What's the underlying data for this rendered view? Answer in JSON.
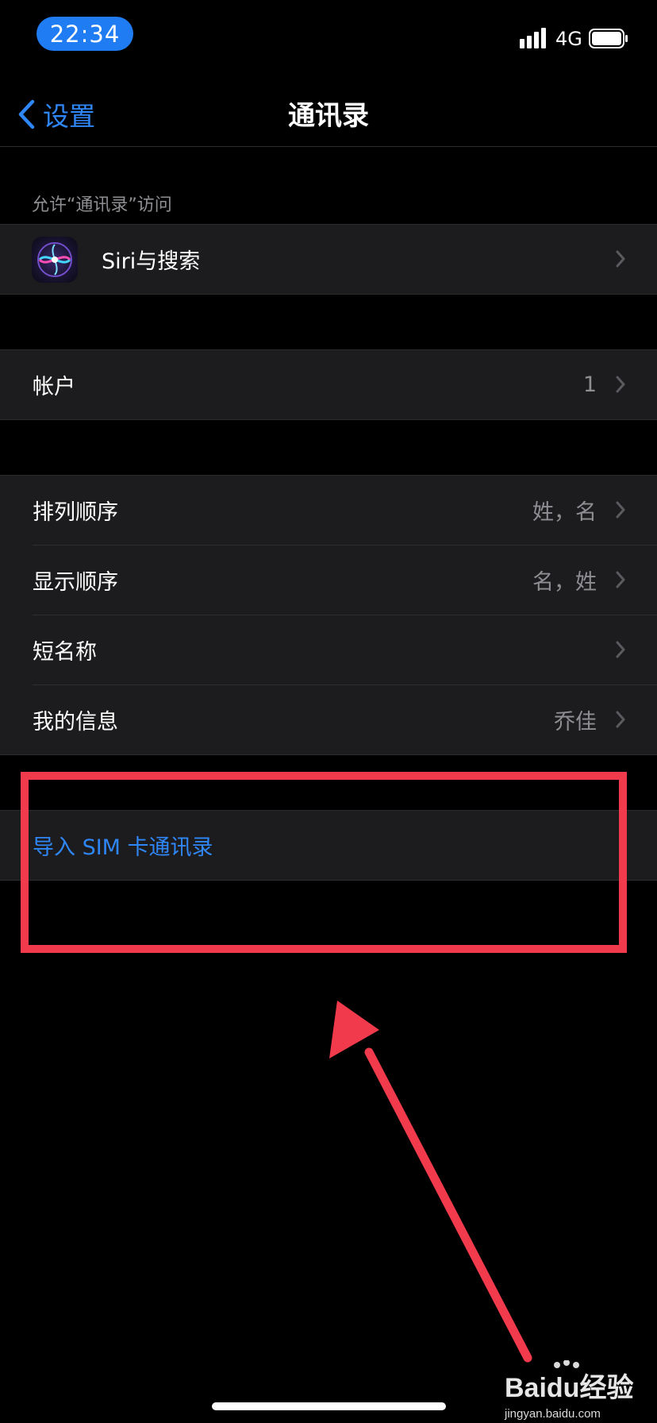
{
  "status_bar": {
    "time": "22:34",
    "network": "4G"
  },
  "nav": {
    "back_label": "设置",
    "title": "通讯录"
  },
  "section_header": "允许“通讯录”访问",
  "groups": {
    "siri": {
      "label": "Siri与搜索"
    },
    "accounts": {
      "label": "帐户",
      "value": "1"
    },
    "display": {
      "items": [
        {
          "label": "排列顺序",
          "value": "姓，名"
        },
        {
          "label": "显示顺序",
          "value": "名，姓"
        },
        {
          "label": "短名称",
          "value": ""
        },
        {
          "label": "我的信息",
          "value": "乔佳"
        }
      ]
    },
    "import": {
      "label": "导入 SIM 卡通讯录"
    }
  },
  "watermark": {
    "text": "Baidu经验",
    "subtext": "jingyan.baidu.com"
  },
  "colors": {
    "accent": "#2f86f6",
    "annotation": "#f13a4c",
    "background": "#000000",
    "cell": "#1c1c1e"
  }
}
